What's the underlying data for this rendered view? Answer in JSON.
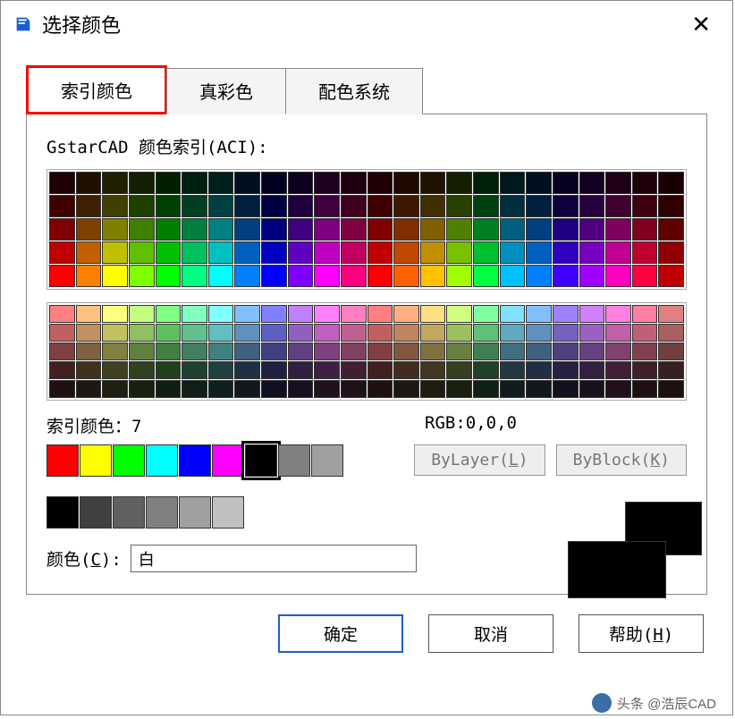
{
  "titlebar": {
    "title": "选择颜色"
  },
  "tabs": [
    {
      "label": "索引颜色",
      "active": true
    },
    {
      "label": "真彩色",
      "active": false
    },
    {
      "label": "配色系统",
      "active": false
    }
  ],
  "panel": {
    "aci_label": "GstarCAD 颜色索引(ACI):",
    "index_label_prefix": "索引颜色：",
    "index_value": "7",
    "rgb_label": "RGB:",
    "rgb_value": "0,0,0",
    "bylayer_label": "ByLayer(",
    "bylayer_key": "L",
    "bylayer_tail": ")",
    "byblock_label": "ByBlock(",
    "byblock_key": "K",
    "byblock_tail": ")",
    "color_field_label": "颜色(",
    "color_field_key": "C",
    "color_field_tail": "):",
    "color_field_value": "白",
    "upper_rows": [
      [
        "#200000",
        "#201000",
        "#202000",
        "#102000",
        "#002000",
        "#002010",
        "#002020",
        "#001020",
        "#000020",
        "#100020",
        "#200020",
        "#200010",
        "#200000",
        "#200800",
        "#201200",
        "#142000",
        "#002008",
        "#001820",
        "#001020",
        "#080020",
        "#140020",
        "#200018",
        "#200008",
        "#180000"
      ],
      [
        "#400000",
        "#402000",
        "#404000",
        "#204000",
        "#004000",
        "#004020",
        "#004040",
        "#002040",
        "#000040",
        "#200040",
        "#400040",
        "#400020",
        "#400000",
        "#401800",
        "#403000",
        "#284000",
        "#004010",
        "#003040",
        "#002040",
        "#100040",
        "#280040",
        "#400030",
        "#400010",
        "#300000"
      ],
      [
        "#800000",
        "#804000",
        "#808000",
        "#408000",
        "#008000",
        "#008040",
        "#008080",
        "#004080",
        "#000080",
        "#400080",
        "#800080",
        "#800040",
        "#800000",
        "#803000",
        "#806000",
        "#508000",
        "#008020",
        "#006080",
        "#004080",
        "#200080",
        "#500080",
        "#800060",
        "#800020",
        "#600000"
      ],
      [
        "#c00000",
        "#c06000",
        "#c0c000",
        "#60c000",
        "#00c000",
        "#00c060",
        "#00c0c0",
        "#0060c0",
        "#0000c0",
        "#6000c0",
        "#c000c0",
        "#c00060",
        "#c00000",
        "#c04800",
        "#c09000",
        "#78c000",
        "#00c030",
        "#0090c0",
        "#0060c0",
        "#3000c0",
        "#7800c0",
        "#c00090",
        "#c00030",
        "#900000"
      ],
      [
        "#ff0000",
        "#ff8000",
        "#ffff00",
        "#80ff00",
        "#00ff00",
        "#00ff80",
        "#00ffff",
        "#0080ff",
        "#0000ff",
        "#8000ff",
        "#ff00ff",
        "#ff0080",
        "#ff0000",
        "#ff6000",
        "#ffc000",
        "#a0ff00",
        "#00ff40",
        "#00c0ff",
        "#0080ff",
        "#4000ff",
        "#a000ff",
        "#ff00c0",
        "#ff0040",
        "#c00000"
      ]
    ],
    "lower_rows": [
      [
        "#ff8080",
        "#ffc080",
        "#ffff80",
        "#c0ff80",
        "#80ff80",
        "#80ffc0",
        "#80ffff",
        "#80c0ff",
        "#8080ff",
        "#c080ff",
        "#ff80ff",
        "#ff80c0",
        "#ff8080",
        "#ffb080",
        "#ffe080",
        "#d0ff80",
        "#80ffa0",
        "#80e0ff",
        "#80c0ff",
        "#a080ff",
        "#d080ff",
        "#ff80e0",
        "#ff80a0",
        "#e08080"
      ],
      [
        "#c06060",
        "#c09060",
        "#c0c060",
        "#90c060",
        "#60c060",
        "#60c090",
        "#60c0c0",
        "#6090c0",
        "#6060c0",
        "#9060c0",
        "#c060c0",
        "#c06090",
        "#c06060",
        "#c08460",
        "#c0a860",
        "#9cc060",
        "#60c078",
        "#60a8c0",
        "#6090c0",
        "#7860c0",
        "#9c60c0",
        "#c060a8",
        "#c06078",
        "#a86060"
      ],
      [
        "#804040",
        "#806040",
        "#808040",
        "#608040",
        "#408040",
        "#408060",
        "#408080",
        "#406080",
        "#404080",
        "#604080",
        "#804080",
        "#804060",
        "#804040",
        "#805840",
        "#807040",
        "#688040",
        "#408050",
        "#407080",
        "#406080",
        "#504080",
        "#684080",
        "#804070",
        "#804050",
        "#704040"
      ],
      [
        "#402020",
        "#403020",
        "#404020",
        "#304020",
        "#204020",
        "#204030",
        "#204040",
        "#203040",
        "#202040",
        "#302040",
        "#402040",
        "#402030",
        "#402020",
        "#402c20",
        "#403820",
        "#344020",
        "#204028",
        "#203840",
        "#203040",
        "#282040",
        "#342040",
        "#402038",
        "#402028",
        "#382020"
      ],
      [
        "#201010",
        "#201810",
        "#202010",
        "#182010",
        "#102010",
        "#102018",
        "#102020",
        "#101820",
        "#101020",
        "#181020",
        "#201020",
        "#201018",
        "#201010",
        "#201610",
        "#201c10",
        "#1a2010",
        "#102014",
        "#101c20",
        "#101820",
        "#141020",
        "#1a1020",
        "#20101c",
        "#201014",
        "#1c1010"
      ]
    ],
    "std_colors": [
      {
        "hex": "#ff0000",
        "selected": false
      },
      {
        "hex": "#ffff00",
        "selected": false
      },
      {
        "hex": "#00ff00",
        "selected": false
      },
      {
        "hex": "#00ffff",
        "selected": false
      },
      {
        "hex": "#0000ff",
        "selected": false
      },
      {
        "hex": "#ff00ff",
        "selected": false
      },
      {
        "hex": "#000000",
        "selected": true
      },
      {
        "hex": "#808080",
        "selected": false
      },
      {
        "hex": "#a0a0a0",
        "selected": false
      }
    ],
    "gray_colors": [
      "#000000",
      "#404040",
      "#606060",
      "#808080",
      "#a0a0a0",
      "#c0c0c0"
    ]
  },
  "footer": {
    "ok": "确定",
    "cancel": "取消",
    "help_pre": "帮助(",
    "help_key": "H",
    "help_tail": ")"
  },
  "watermark": "头条 @浩辰CAD"
}
